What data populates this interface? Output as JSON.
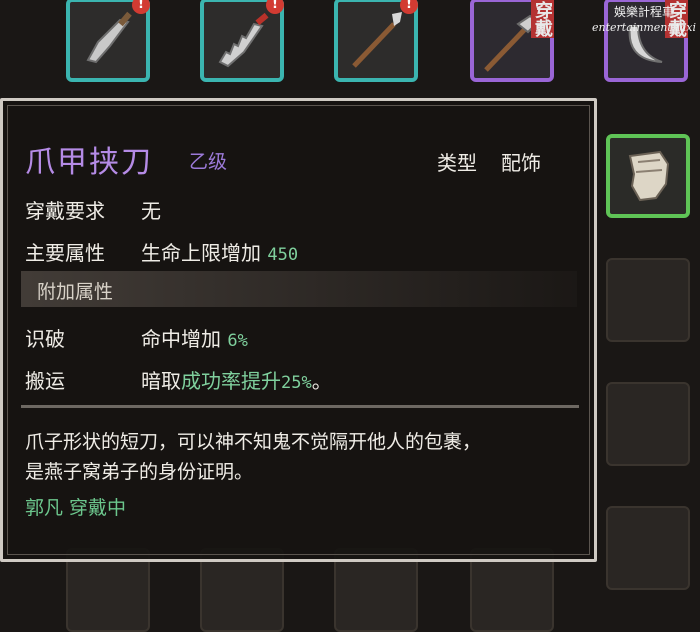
{
  "watermark": {
    "line1": "娛樂計程車",
    "line2": "entertainment taxi"
  },
  "slots_top": [
    {
      "icon": "broadsword-icon",
      "frame": "teal",
      "alert": "!"
    },
    {
      "icon": "serrated-saber-icon",
      "frame": "teal",
      "alert": "!"
    },
    {
      "icon": "spear-icon",
      "frame": "teal",
      "alert": "!"
    },
    {
      "icon": "halberd-icon",
      "frame": "purple",
      "badge": "穿戴"
    },
    {
      "icon": "crescent-blade-icon",
      "frame": "purple",
      "badge": "穿戴"
    }
  ],
  "slot_right": {
    "icon": "claw-glove-icon",
    "frame": "green"
  },
  "worn_badge": "穿戴",
  "tooltip": {
    "name": "爪甲挟刀",
    "grade": "乙级",
    "type_label": "类型",
    "type_value": "配饰",
    "requirement_label": "穿戴要求",
    "requirement_value": "无",
    "main_attr_label": "主要属性",
    "main_attr_text": "生命上限增加",
    "main_attr_value": "450",
    "extra_section": "附加属性",
    "extra1_label": "识破",
    "extra1_text": "命中增加",
    "extra1_value": "6%",
    "extra2_label": "搬运",
    "extra2_prefix": "暗取",
    "extra2_highlight": "成功率提升",
    "extra2_value": "25%",
    "extra2_suffix": "。",
    "description_line1": "爪子形状的短刀，可以神不知鬼不觉隔开他人的包裹，",
    "description_line2": "是燕子窝弟子的身份证明。",
    "equipped_status": "郭凡 穿戴中"
  },
  "colors": {
    "teal_frame": "#3bb5b0",
    "purple_frame": "#9a66d6",
    "green_frame": "#5fc456",
    "item_name": "#b58be6",
    "stat_green": "#7fd09d",
    "alert_red": "#d23b32"
  }
}
